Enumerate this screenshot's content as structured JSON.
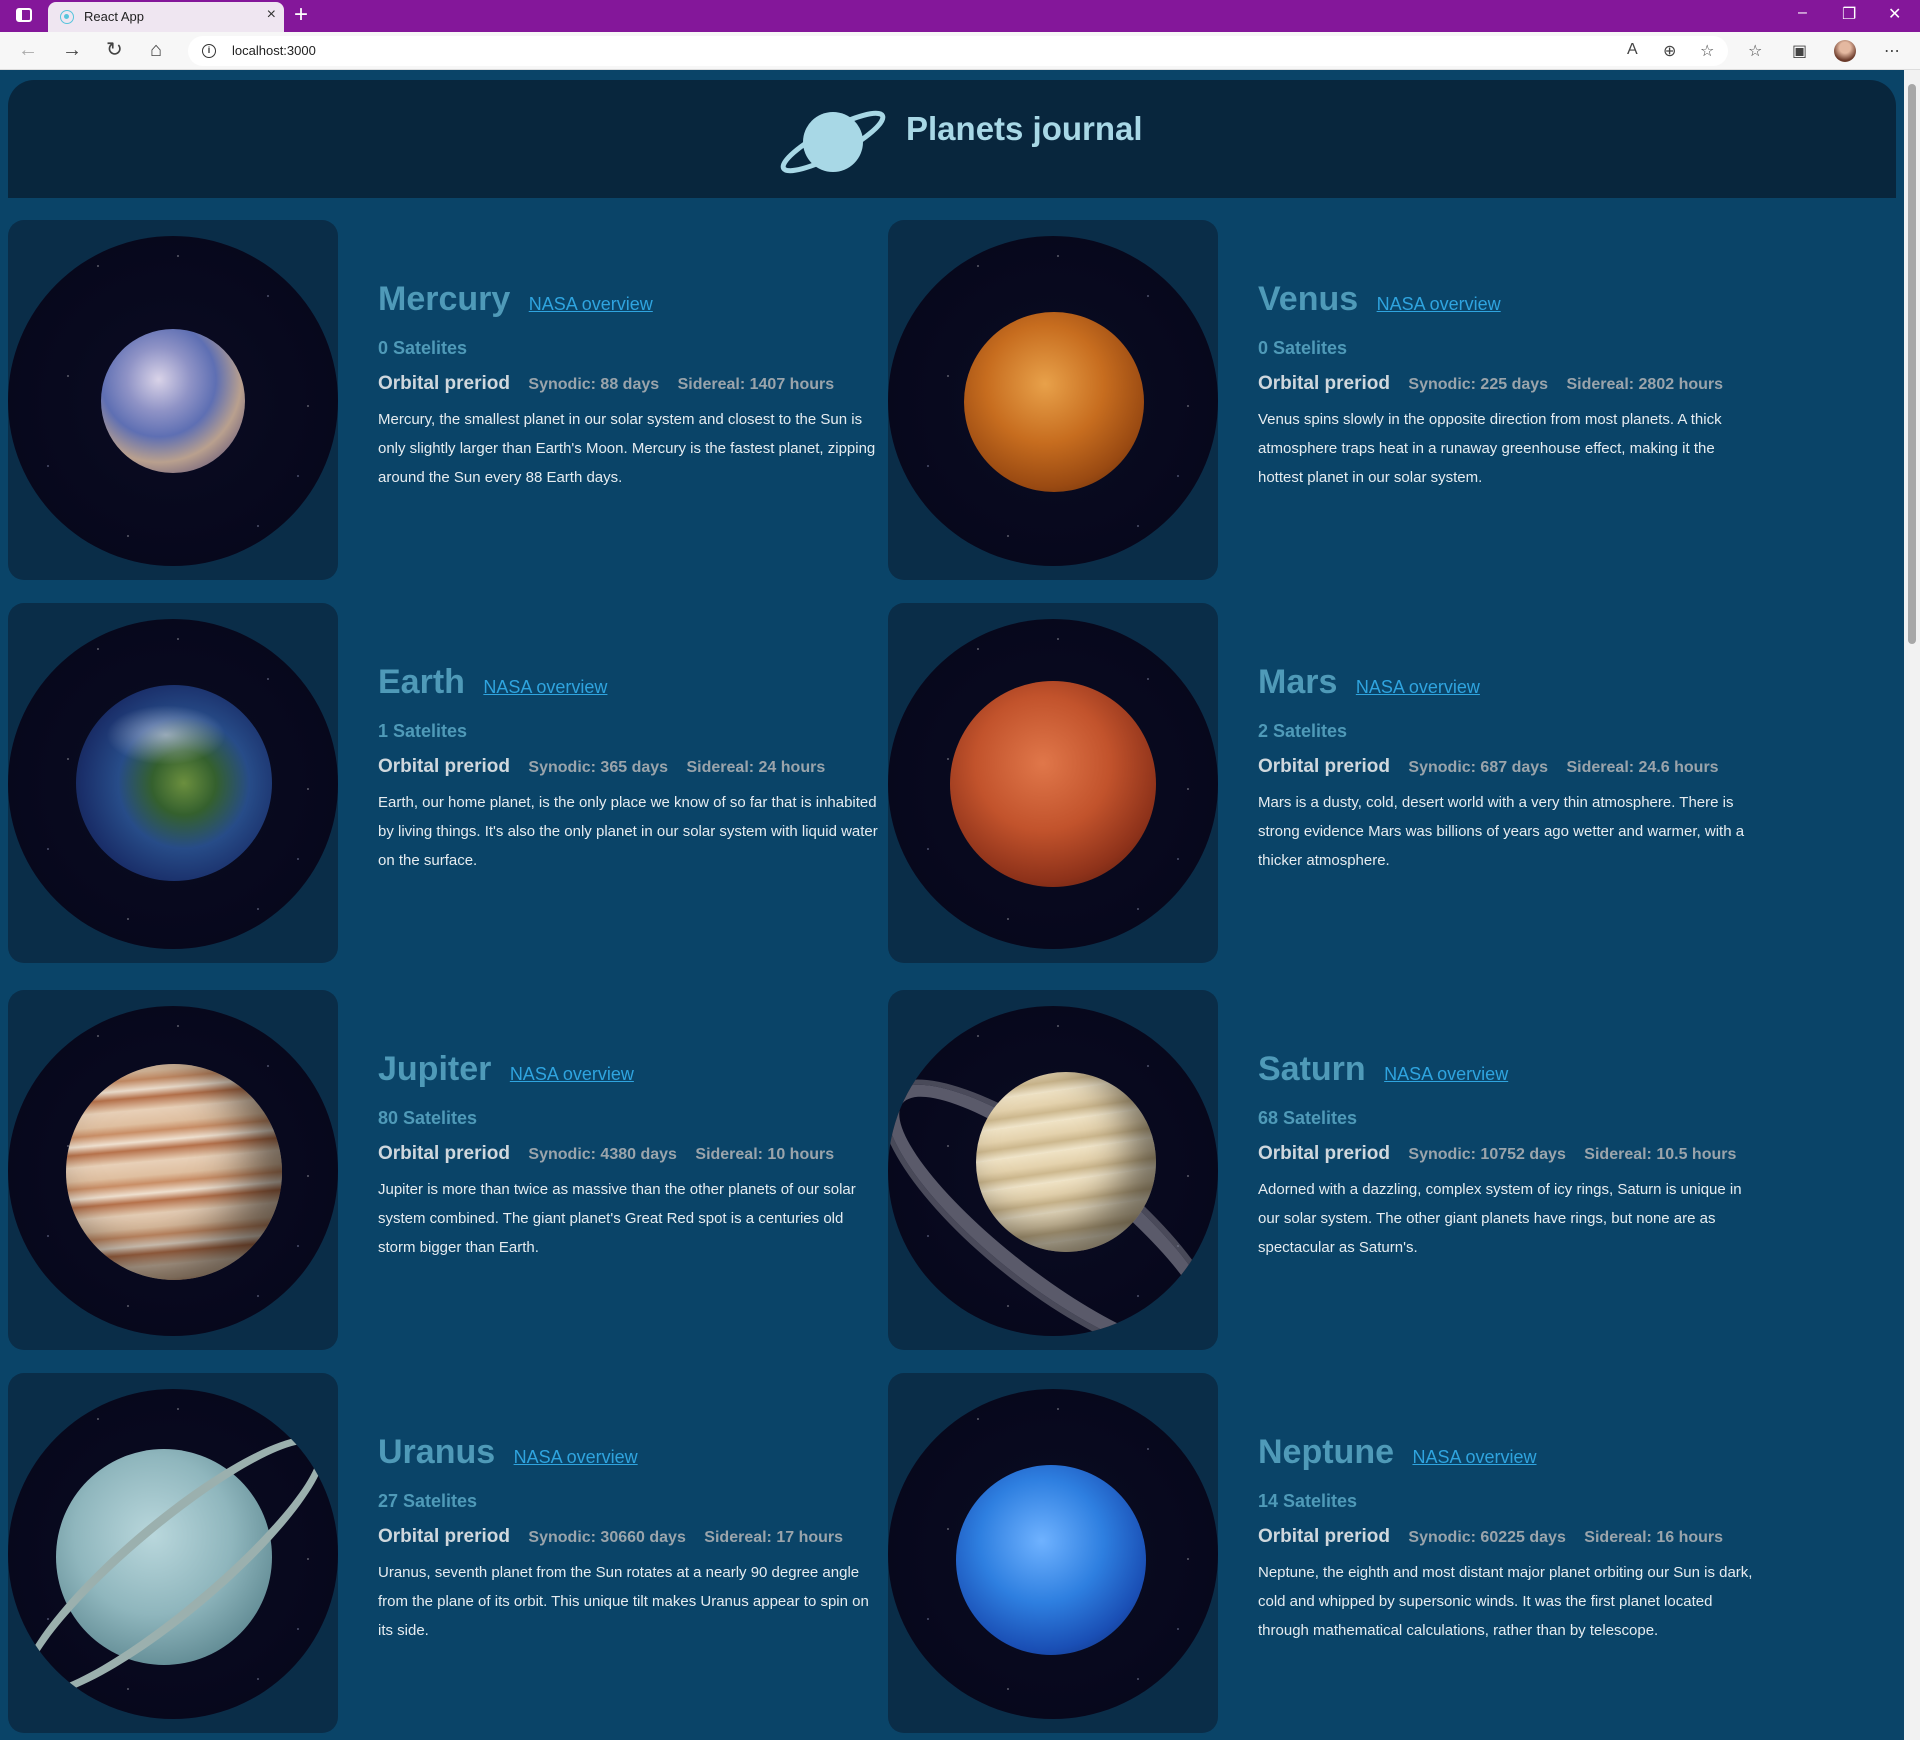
{
  "browser": {
    "tab_title": "React App",
    "url": "localhost:3000"
  },
  "site": {
    "title": "Planets journal"
  },
  "planets": [
    {
      "name": "Mercury",
      "link": "NASA overview",
      "satellites": "0 Satelites",
      "orbital_label": "Orbital preriod",
      "synodic": "Synodic: 88 days",
      "sidereal": "Sidereal: 1407 hours",
      "description": "Mercury, the smallest planet in our solar system and closest to the Sun is only slightly larger than Earth's Moon. Mercury is the fastest planet, zipping around the Sun every 88 Earth days."
    },
    {
      "name": "Venus",
      "link": "NASA overview",
      "satellites": "0 Satelites",
      "orbital_label": "Orbital preriod",
      "synodic": "Synodic: 225 days",
      "sidereal": "Sidereal: 2802 hours",
      "description": "Venus spins slowly in the opposite direction from most planets. A thick atmosphere traps heat in a runaway greenhouse effect, making it the hottest planet in our solar system."
    },
    {
      "name": "Earth",
      "link": "NASA overview",
      "satellites": "1 Satelites",
      "orbital_label": "Orbital preriod",
      "synodic": "Synodic: 365 days",
      "sidereal": "Sidereal: 24 hours",
      "description": "Earth, our home planet, is the only place we know of so far that is inhabited by living things. It's also the only planet in our solar system with liquid water on the surface."
    },
    {
      "name": "Mars",
      "link": "NASA overview",
      "satellites": "2 Satelites",
      "orbital_label": "Orbital preriod",
      "synodic": "Synodic: 687 days",
      "sidereal": "Sidereal: 24.6 hours",
      "description": "Mars is a dusty, cold, desert world with a very thin atmosphere. There is strong evidence Mars was billions of years ago wetter and warmer, with a thicker atmosphere."
    },
    {
      "name": "Jupiter",
      "link": "NASA overview",
      "satellites": "80 Satelites",
      "orbital_label": "Orbital preriod",
      "synodic": "Synodic: 4380 days",
      "sidereal": "Sidereal: 10 hours",
      "description": "Jupiter is more than twice as massive than the other planets of our solar system combined. The giant planet's Great Red spot is a centuries old storm bigger than Earth."
    },
    {
      "name": "Saturn",
      "link": "NASA overview",
      "satellites": "68 Satelites",
      "orbital_label": "Orbital preriod",
      "synodic": "Synodic: 10752 days",
      "sidereal": "Sidereal: 10.5 hours",
      "description": "Adorned with a dazzling, complex system of icy rings, Saturn is unique in our solar system. The other giant planets have rings, but none are as spectacular as Saturn's."
    },
    {
      "name": "Uranus",
      "link": "NASA overview",
      "satellites": "27 Satelites",
      "orbital_label": "Orbital preriod",
      "synodic": "Synodic: 30660 days",
      "sidereal": "Sidereal: 17 hours",
      "description": "Uranus, seventh planet from the Sun rotates at a nearly 90 degree angle from the plane of its orbit. This unique tilt makes Uranus appear to spin on its side."
    },
    {
      "name": "Neptune",
      "link": "NASA overview",
      "satellites": "14 Satelites",
      "orbital_label": "Orbital preriod",
      "synodic": "Synodic: 60225 days",
      "sidereal": "Sidereal: 16 hours",
      "description": "Neptune, the eighth and most distant major planet orbiting our Sun is dark, cold and whipped by supersonic winds. It was the first planet located through mathematical calculations, rather than by telescope."
    }
  ],
  "colors": {
    "titlebar": "#84179a",
    "page_background": "#0a4468",
    "header_background": "#08263d",
    "planet_name": "#4f9ab8",
    "link": "#2fa4df"
  }
}
